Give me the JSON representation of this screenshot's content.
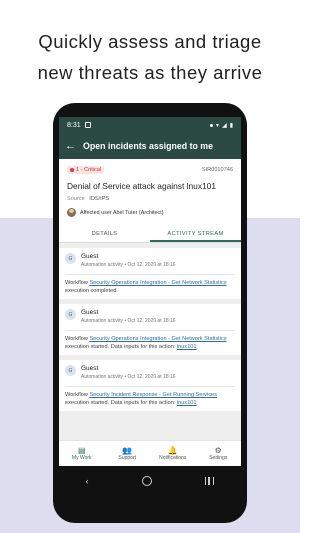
{
  "headline": {
    "line1": "Quickly assess and triage",
    "line2": "new threats as they arrive"
  },
  "status_bar": {
    "time": "8:31",
    "icons": [
      "notification-icon",
      "wifi-icon",
      "signal-icon",
      "battery-icon"
    ]
  },
  "app_bar": {
    "title": "Open incidents assigned to me",
    "back_icon": "arrow-left-icon"
  },
  "incident": {
    "severity": "1 - Critical",
    "id": "SIR0010746",
    "title": "Denial of Service attack against lnux101",
    "source_label": "Source",
    "source_value": "IDS/IPS",
    "affected_user": "Affected user Abel Tuter (Architect)"
  },
  "tabs": [
    {
      "label": "DETAILS",
      "active": false
    },
    {
      "label": "ACTIVITY STREAM",
      "active": true
    }
  ],
  "activity": [
    {
      "avatar": "G",
      "who": "Guest",
      "meta": "Automation activity • Oct 12, 2020 at 18:16",
      "pre": "Workflow ",
      "link": "Security Operations Integration - Get Network Statistics",
      "post": " execution completed.",
      "link2": ""
    },
    {
      "avatar": "G",
      "who": "Guest",
      "meta": "Automation activity • Oct 12, 2020 at 18:16",
      "pre": "Workflow ",
      "link": "Security Operations Integration - Get Network Statistics",
      "post": " execution started. Data inputs for this action: ",
      "link2": "lnux101"
    },
    {
      "avatar": "G",
      "who": "Guest",
      "meta": "Automation activity • Oct 12, 2020 at 18:16",
      "pre": "Workflow ",
      "link": "Security Incident Response - Get Running Services",
      "post": " execution started. Data inputs for this action: ",
      "link2": "lnux101"
    }
  ],
  "bottom_nav": [
    {
      "label": "My Work",
      "icon": "inbox-icon",
      "active": true
    },
    {
      "label": "Support",
      "icon": "people-icon",
      "active": false
    },
    {
      "label": "Notifications",
      "icon": "bell-icon",
      "active": false
    },
    {
      "label": "Settings",
      "icon": "gear-icon",
      "active": false
    }
  ],
  "colors": {
    "header": "#2b4a44",
    "accent": "#2d6e5e",
    "critical": "#d93a3a",
    "link": "#2d6e9e"
  }
}
